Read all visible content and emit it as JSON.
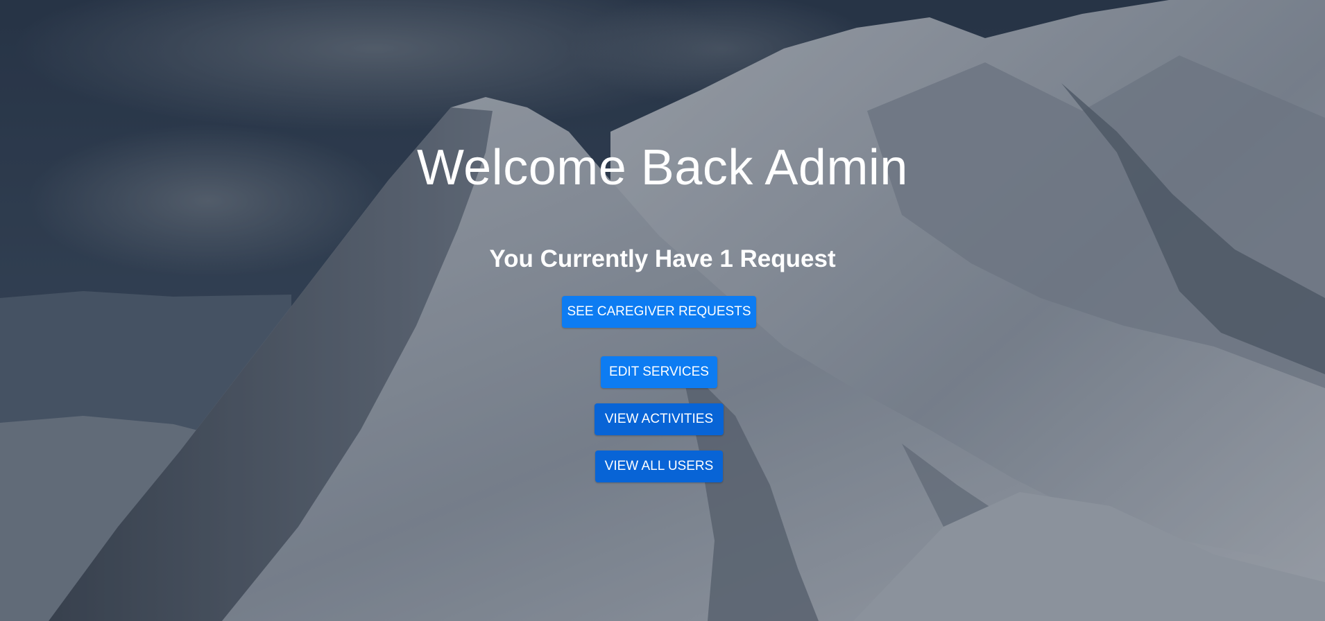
{
  "hero": {
    "title": "Welcome Back Admin",
    "request_message": "You Currently Have 1 Request"
  },
  "actions": {
    "see_requests_label": "SEE CAREGIVER REQUESTS",
    "edit_services_label": "EDIT SERVICES",
    "view_activities_label": "VIEW ACTIVITIES",
    "view_all_users_label": "VIEW ALL USERS"
  },
  "colors": {
    "button_primary": "#0d7cf2",
    "button_dark": "#0864d6",
    "text": "#ffffff"
  }
}
